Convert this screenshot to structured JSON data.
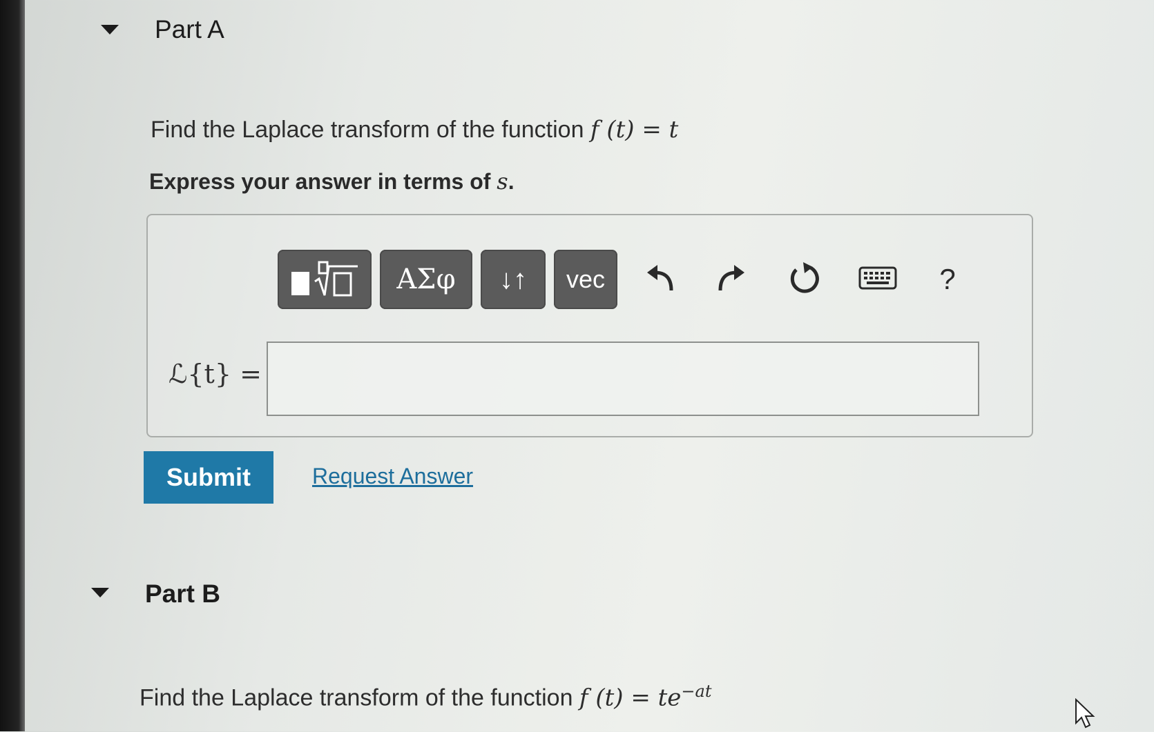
{
  "part_a": {
    "title": "Part A",
    "question_prefix": "Find the Laplace transform of the function ",
    "question_math": "f (t) = t",
    "instruction_prefix": "Express your answer in terms of ",
    "instruction_var": "s",
    "instruction_suffix": ".",
    "toolbar": {
      "greek_label": "ΑΣφ",
      "arrows_label": "↓↑",
      "vec_label": "vec",
      "help_label": "?"
    },
    "equation_label": "ℒ{t} =",
    "answer_value": "",
    "submit_label": "Submit",
    "request_label": "Request Answer"
  },
  "part_b": {
    "title": "Part B",
    "question_prefix": "Find the Laplace transform of the function ",
    "question_math": "f (t) = te",
    "question_exponent": "−at"
  },
  "colors": {
    "submit_bg": "#1f79a7",
    "link": "#1d6e9c",
    "toolbar_btn": "#5b5b5b"
  }
}
